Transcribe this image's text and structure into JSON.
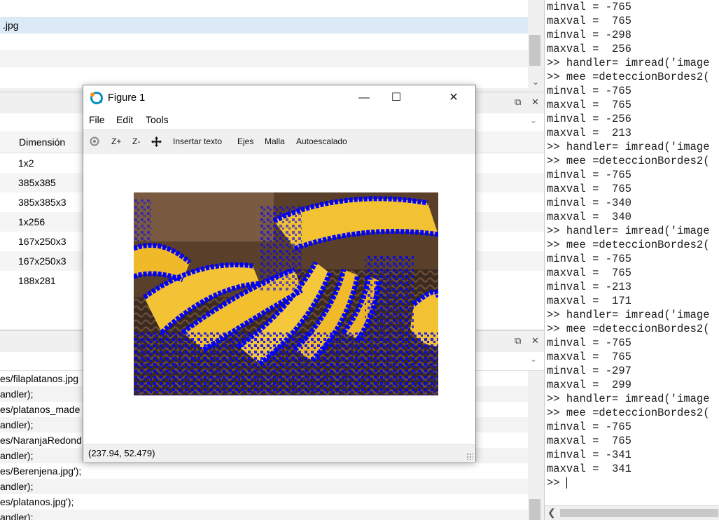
{
  "file_browser": {
    "rows": [
      "",
      ".jpg",
      "",
      "",
      ""
    ]
  },
  "workspace": {
    "column_header": "Dimensión",
    "rows": [
      "1x2",
      "385x385",
      "385x385x3",
      "1x256",
      "167x250x3",
      "167x250x3",
      "188x281"
    ]
  },
  "history": {
    "rows": [
      "es/filaplatanos.jpg",
      "andler);",
      "es/platanos_made",
      "andler);",
      "es/NaranjaRedond",
      "andler);",
      "es/Berenjena.jpg');",
      "andler);",
      "es/platanos.jpg');",
      "andler);"
    ]
  },
  "command_window": {
    "lines": [
      "minval = -765",
      "maxval =  765",
      "minval = -298",
      "maxval =  256",
      ">> handler= imread('image",
      ">> mee =deteccionBordes2(",
      "minval = -765",
      "maxval =  765",
      "minval = -256",
      "maxval =  213",
      ">> handler= imread('image",
      ">> mee =deteccionBordes2(",
      "minval = -765",
      "maxval =  765",
      "minval = -340",
      "maxval =  340",
      ">> handler= imread('image",
      ">> mee =deteccionBordes2(",
      "minval = -765",
      "maxval =  765",
      "minval = -213",
      "maxval =  171",
      ">> handler= imread('image",
      ">> mee =deteccionBordes2(",
      "minval = -765",
      "maxval =  765",
      "minval = -297",
      "maxval =  299",
      ">> handler= imread('image",
      ">> mee =deteccionBordes2(",
      "minval = -765",
      "maxval =  765",
      "minval = -341",
      "maxval =  341"
    ],
    "prompt": ">> "
  },
  "figure": {
    "title": "Figure 1",
    "menu": {
      "file": "File",
      "edit": "Edit",
      "tools": "Tools"
    },
    "toolbar": {
      "rotate_icon": "rotate-icon",
      "zoom_in": "Z+",
      "zoom_out": "Z-",
      "pan_icon": "pan-arrows-icon",
      "insert_text": "Insertar texto",
      "axes": "Ejes",
      "grid": "Malla",
      "autoscale": "Autoescalado"
    },
    "coordinates": "(237.94, 52.479)",
    "image": {
      "subject": "bananas",
      "edge_color": "#0000ff"
    }
  },
  "colors": {
    "selection": "#dce9f6",
    "edge_overlay": "#0000ff",
    "banana": "#f2c12e",
    "basket": "#4a3425"
  }
}
